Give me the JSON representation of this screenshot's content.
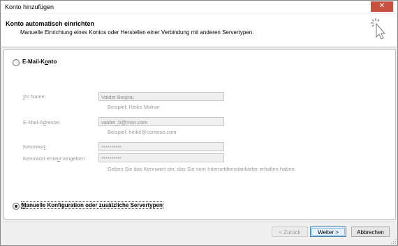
{
  "window": {
    "title": "Konto hinzufügen",
    "close_glyph": "✕"
  },
  "header": {
    "title": "Konto automatisch einrichten",
    "subtitle": "Manuelle Einrichtung eines Kontos oder Herstellen einer Verbindung mit anderen Servertypen.",
    "icon": "wizard-cursor-icon"
  },
  "email_option": {
    "label_pre": "E-Mail-K",
    "label_accel": "o",
    "label_post": "nto",
    "selected": false
  },
  "form": {
    "name": {
      "label_accel": "I",
      "label_rest": "hr Name:",
      "value": "Valdet Beqiraj",
      "hint": "Beispiel: Heike Molnar"
    },
    "email": {
      "label_pre": "E-Mail-A",
      "label_accel": "d",
      "label_post": "resse:",
      "value": "valdet_b@msn.com",
      "hint": "Beispiel: heike@contoso.com"
    },
    "password": {
      "label_pre": "Kennwor",
      "label_accel": "t",
      "label_post": ":",
      "value": "**********"
    },
    "password_confirm": {
      "label_pre": "Kennwort erne",
      "label_accel": "u",
      "label_post": "t eingeben:",
      "value": "**********",
      "hint": "Geben Sie das Kennwort ein, das Sie vom Internetdienstanbieter erhalten haben."
    }
  },
  "manual_option": {
    "label_accel": "M",
    "label_rest": "anuelle Konfiguration oder zusätzliche Servertypen",
    "selected": true
  },
  "buttons": {
    "back": "< Zurück",
    "next": "Weiter >",
    "cancel": "Abbrechen"
  }
}
